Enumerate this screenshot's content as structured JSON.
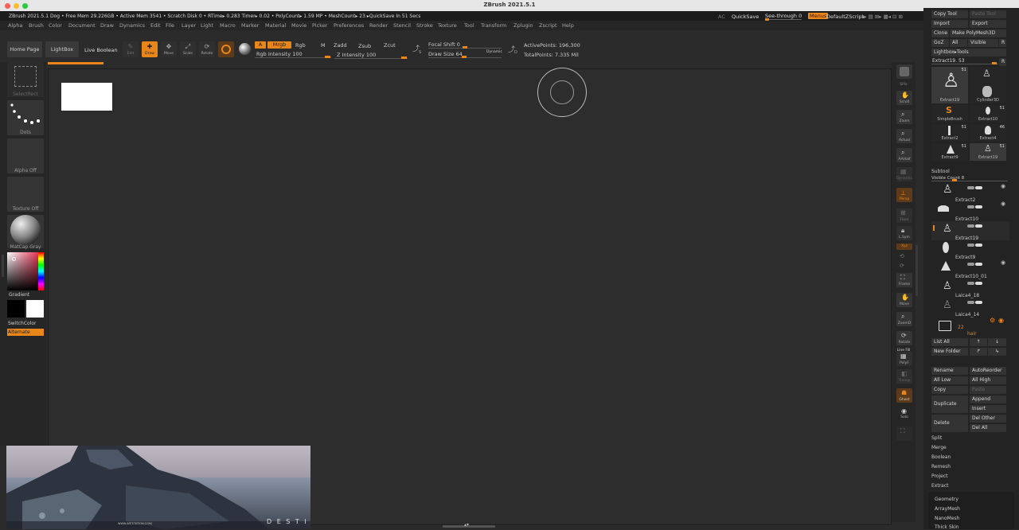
{
  "window": {
    "title": "ZBrush 2021.5.1"
  },
  "infobar": {
    "text": "ZBrush 2021.5.1 Dog   • Free Mem 29.226GB • Active Mem 3541 • Scratch Disk 0 •  RTime▸ 0.283 Timer▸ 0.02 • PolyCount▸ 1.59 MP  • MeshCount▸ 23  ▸QuickSave In 51 Secs",
    "ac": "AC",
    "quicksave": "QuickSave",
    "see_through": "See-through  0",
    "menus": "Menus",
    "default_zscript": "DefaultZScript"
  },
  "menus": [
    "Alpha",
    "Brush",
    "Color",
    "Document",
    "Draw",
    "Dynamics",
    "Edit",
    "File",
    "Layer",
    "Light",
    "Macro",
    "Marker",
    "Material",
    "Movie",
    "Picker",
    "Preferences",
    "Render",
    "Stencil",
    "Stroke",
    "Texture",
    "Tool",
    "Transform",
    "Zplugin",
    "Zscript",
    "Help"
  ],
  "toolbar": {
    "home_page": "Home Page",
    "lightbox": "LightBox",
    "live_boolean": "Live Boolean",
    "edit": "Edit",
    "draw": "Draw",
    "move": "Move",
    "scale": "Scale",
    "rotate": "Rotate",
    "a": "A",
    "mrgb": "Mrgb",
    "rgb": "Rgb",
    "m": "M",
    "rgb_intensity": "Rgb Intensity 100",
    "zadd": "Zadd",
    "zsub": "Zsub",
    "zcut": "Zcut",
    "z_intensity": "Z Intensity 100",
    "s_icon": "S",
    "focal_shift": "Focal Shift 0",
    "draw_size": "Draw Size 64",
    "dynamic": "Dynamic",
    "d_icon": "D",
    "active_points": "ActivePoints: 196,300",
    "total_points": "TotalPoints: 7.335 Mil"
  },
  "left_shelf": {
    "select_rect": "SelectRect",
    "dots": "Dots",
    "alpha_off": "Alpha Off",
    "texture_off": "Texture Off",
    "matcap": "MatCap Gray",
    "gradient": "Gradient",
    "switch_color": "SwitchColor",
    "alternate": "Alternate"
  },
  "right_shelf": [
    "SPix",
    "Scroll",
    "Zoom",
    "Actual",
    "AAHalf",
    "Dynamic",
    "Persp",
    "Floor",
    "L.Sym",
    "Xyz",
    "Frame",
    "Move",
    "ZoomD",
    "Rotate",
    "Line Fill",
    "PolyF",
    "Transp",
    "Ghost",
    "Solo",
    "Xpose"
  ],
  "tool_panel": {
    "copy_tool": "Copy Tool",
    "paste_tool": "Paste Tool",
    "import": "Import",
    "export": "Export",
    "clone": "Clone",
    "make_polymesh": "Make PolyMesh3D",
    "goz": "GoZ",
    "all": "All",
    "visible": "Visible",
    "r": "R",
    "lightbox_tools": "Lightbox▸Tools",
    "current_tool": "Extract19. 53",
    "r2": "R",
    "thumbs": [
      {
        "name": "Extract19",
        "count": "51"
      },
      {
        "name": "Cylinder3D",
        "count": ""
      },
      {
        "name": "SimpleBrush",
        "count": ""
      },
      {
        "name": "Extract10",
        "count": "51"
      },
      {
        "name": "Extract2",
        "count": "51"
      },
      {
        "name": "Extract4",
        "count": "46"
      },
      {
        "name": "Extract9",
        "count": "51"
      },
      {
        "name": "Extract19",
        "count": "51"
      }
    ]
  },
  "subtool": {
    "title": "Subtool",
    "visible_count": "Visible Count 8",
    "items": [
      "",
      "Extract2",
      "Extract10",
      "Extract19",
      "Extract9",
      "Extract10_01",
      "Laica4_18",
      "Laica4_14"
    ],
    "folder_count": "22",
    "folder_name": "hair",
    "list_all": "List All",
    "new_folder": "New Folder",
    "rename": "Rename",
    "auto_reorder": "AutoReorder",
    "all_low": "All Low",
    "all_high": "All High",
    "copy": "Copy",
    "paste": "Paste",
    "duplicate": "Duplicate",
    "append": "Append",
    "insert": "Insert",
    "delete": "Delete",
    "del_other": "Del Other",
    "del_all": "Del All",
    "split": "Split",
    "merge": "Merge",
    "boolean": "Boolean",
    "remesh": "Remesh",
    "project": "Project",
    "extract": "Extract",
    "geometry": "Geometry",
    "arraymesh": "ArrayMesh",
    "nanomesh": "NanoMesh",
    "thick_skin": "Thick Skin"
  },
  "preview": {
    "site": "WWW.ARTSTATION.COM/",
    "word": "D E S T I N"
  }
}
